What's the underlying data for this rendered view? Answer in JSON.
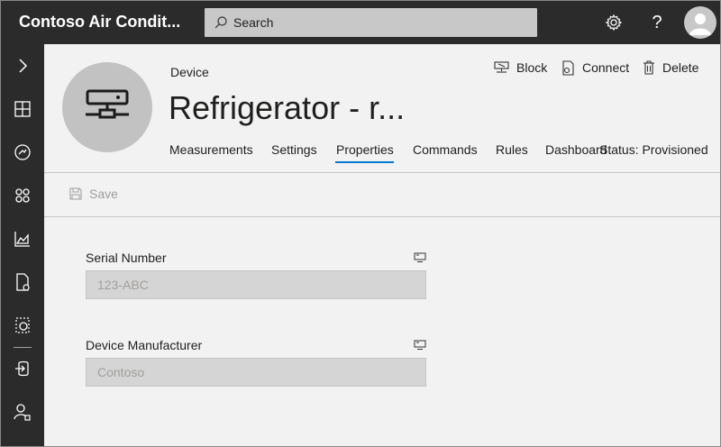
{
  "app": {
    "title": "Contoso Air Condit..."
  },
  "search": {
    "placeholder": "Search"
  },
  "topbar": {
    "icons": [
      "gear-icon",
      "help-icon",
      "user-avatar-icon"
    ],
    "help_glyph": "?"
  },
  "nav": {
    "items": [
      "expand-chevron-icon",
      "dashboard-icon",
      "device-icon",
      "device-groups-icon",
      "analytics-icon",
      "jobs-icon",
      "device-templates-icon",
      "data-export-icon",
      "administration-icon"
    ]
  },
  "device": {
    "kind_label": "Device",
    "title": "Refrigerator - r...",
    "status": "Status: Provisioned"
  },
  "actions": {
    "block": "Block",
    "connect": "Connect",
    "delete": "Delete"
  },
  "tabs": [
    {
      "label": "Measurements",
      "active": false
    },
    {
      "label": "Settings",
      "active": false
    },
    {
      "label": "Properties",
      "active": true
    },
    {
      "label": "Commands",
      "active": false
    },
    {
      "label": "Rules",
      "active": false
    },
    {
      "label": "Dashboard",
      "active": false
    }
  ],
  "toolbar": {
    "save_label": "Save"
  },
  "fields": [
    {
      "label": "Serial Number",
      "value": "123-ABC"
    },
    {
      "label": "Device Manufacturer",
      "value": "Contoso"
    }
  ],
  "colors": {
    "topbar": "#2b2b2b",
    "accent": "#0078d4",
    "background": "#f2f2f2"
  }
}
